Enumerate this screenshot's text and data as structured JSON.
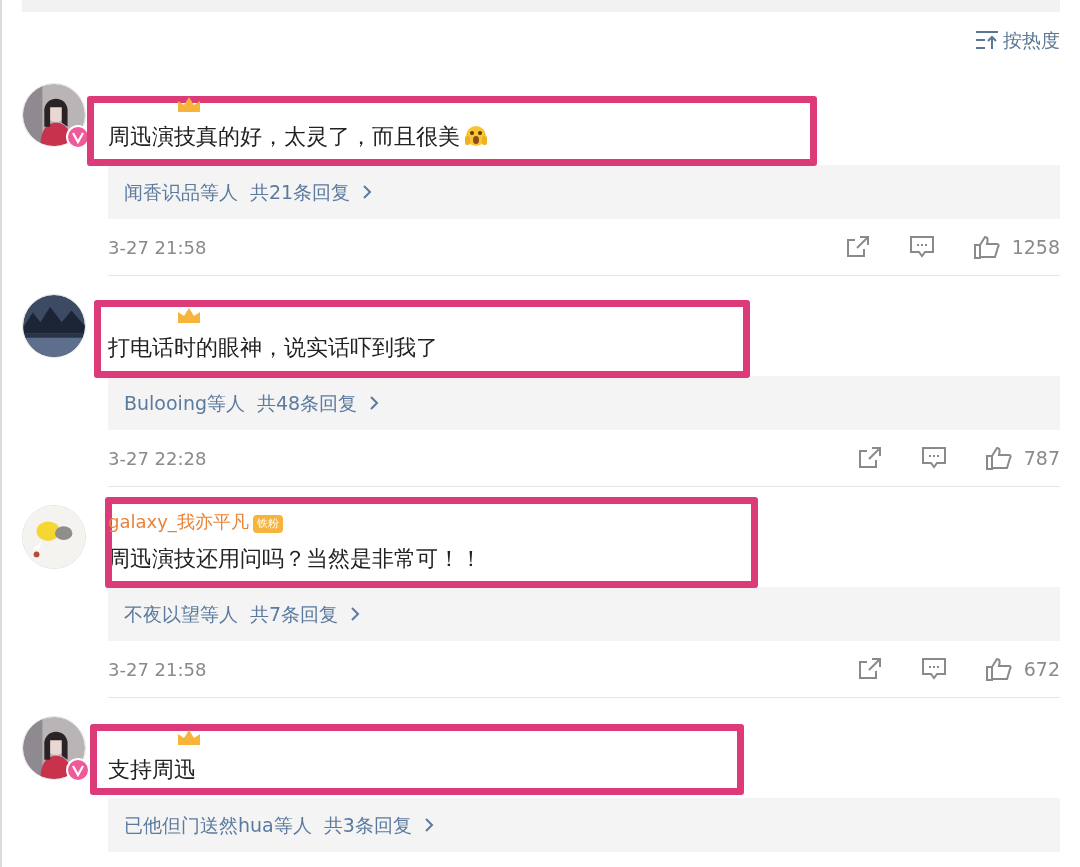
{
  "sort": {
    "label": "按热度"
  },
  "comments": [
    {
      "verified": true,
      "badge": true,
      "text": "周迅演技真的好，太灵了，而且很美",
      "trailing_emoji": true,
      "replies": {
        "users": "闻香识品等人",
        "count": "共21条回复"
      },
      "time": "3-27 21:58",
      "likes": "1258"
    },
    {
      "verified": false,
      "badge": true,
      "text": "打电话时的眼神，说实话吓到我了",
      "trailing_emoji": false,
      "replies": {
        "users": "Bulooing等人",
        "count": "共48条回复"
      },
      "time": "3-27 22:28",
      "likes": "787"
    },
    {
      "verified": false,
      "username": "galaxy_我亦平凡",
      "badge_label": "铁粉",
      "text": "周迅演技还用问吗？当然是非常可！！",
      "trailing_emoji": false,
      "replies": {
        "users": "不夜以望等人",
        "count": "共7条回复"
      },
      "time": "3-27 21:58",
      "likes": "672"
    },
    {
      "verified": true,
      "badge": true,
      "text": "支持周迅",
      "trailing_emoji": false,
      "replies": {
        "users": "已他但门送然hua等人",
        "count": "共3条回复"
      }
    }
  ]
}
